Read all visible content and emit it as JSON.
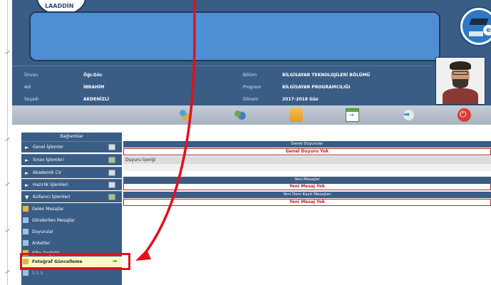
{
  "header": {
    "university_logo_text": "LAADDİN",
    "portal_logo_letter": "e"
  },
  "profile": {
    "unvan_label": "Ünvan",
    "unvan_value": "Öğr.Gör.",
    "ad_label": "Adı",
    "ad_value": "İBRAHİM",
    "soyad_label": "Soyadı",
    "soyad_value": "AKDENİZLİ",
    "bolum_label": "Bölüm",
    "bolum_value": "BİLGİSAYAR TEKNOLOJİLERİ BÖLÜMÜ",
    "program_label": "Program",
    "program_value": "BİLGİSAYAR PROGRAMCILIĞI",
    "donem_label": "Dönem",
    "donem_value": "2017-2018 Güz"
  },
  "toolbar": {
    "icons": [
      "users-icon",
      "people-icon",
      "mail-icon",
      "calendar-icon",
      "arrow-icon",
      "power-icon"
    ]
  },
  "sidebar": {
    "header": "Bağlantılar",
    "menu": [
      {
        "label": "Genel İşlemler",
        "arrow": "►"
      },
      {
        "label": "Sınav İşlemleri",
        "arrow": "►"
      },
      {
        "label": "Akademik CV",
        "arrow": "►"
      },
      {
        "label": "Hazırlık İşlemleri",
        "arrow": "►"
      },
      {
        "label": "Kullanıcı İşlemleri",
        "arrow": "▼"
      }
    ],
    "sub_items": [
      {
        "label": "Gelen Mesajlar"
      },
      {
        "label": "Gönderilen Mesajlar"
      },
      {
        "label": "Duyurular"
      },
      {
        "label": "Anketler"
      },
      {
        "label": "Şifre Değiştir"
      },
      {
        "label": "Fotoğraf Güncelleme"
      },
      {
        "label": "S.S.S."
      }
    ]
  },
  "main": {
    "genel_duyurular_title": "Genel Duyurular",
    "genel_duyurular_empty": "Genel Duyuru Yok",
    "duyuru_icerigi": "Duyuru İçeriği",
    "yeni_mesajlar_title": "Yeni Mesajlar",
    "yeni_mesajlar_empty": "Yeni Mesaj Yok",
    "ders_kayit_title": "Yeni Ders Kayıt Mesajları",
    "ders_kayit_empty": "Yeni Mesaj Yok"
  },
  "colors": {
    "header_blue": "#3a5d86",
    "title_bar_blue": "#4e8fd4",
    "annotation_red": "#e3101a",
    "highlight_yellow": "#fdf8c4"
  }
}
